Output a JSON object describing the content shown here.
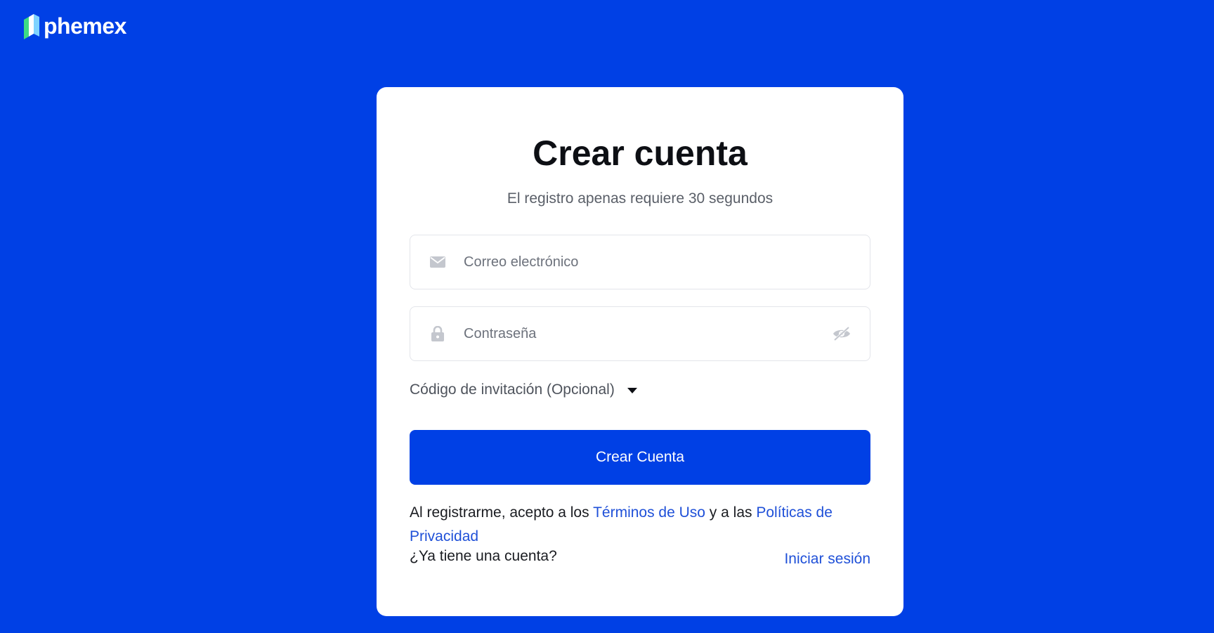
{
  "brand": {
    "name": "phemex"
  },
  "form": {
    "title": "Crear cuenta",
    "subtitle": "El registro apenas requiere 30 segundos",
    "email_placeholder": "Correo electrónico",
    "password_placeholder": "Contraseña",
    "invite_label": "Código de invitación (Opcional)",
    "submit_label": "Crear Cuenta"
  },
  "terms": {
    "prefix": "Al registrarme, acepto a los ",
    "terms_link": "Términos de Uso",
    "middle": " y a las ",
    "privacy_link": "Políticas de Privacidad"
  },
  "login": {
    "question": "¿Ya tiene una cuenta?",
    "link": "Iniciar sesión"
  },
  "icons": {
    "email": "envelope-icon",
    "password": "lock-icon",
    "toggle_visibility": "eye-slash-icon",
    "invite_toggle": "caret-down-icon"
  },
  "colors": {
    "brand_blue": "#0040e5",
    "link_blue": "#1f50d8",
    "card_bg": "#ffffff"
  }
}
